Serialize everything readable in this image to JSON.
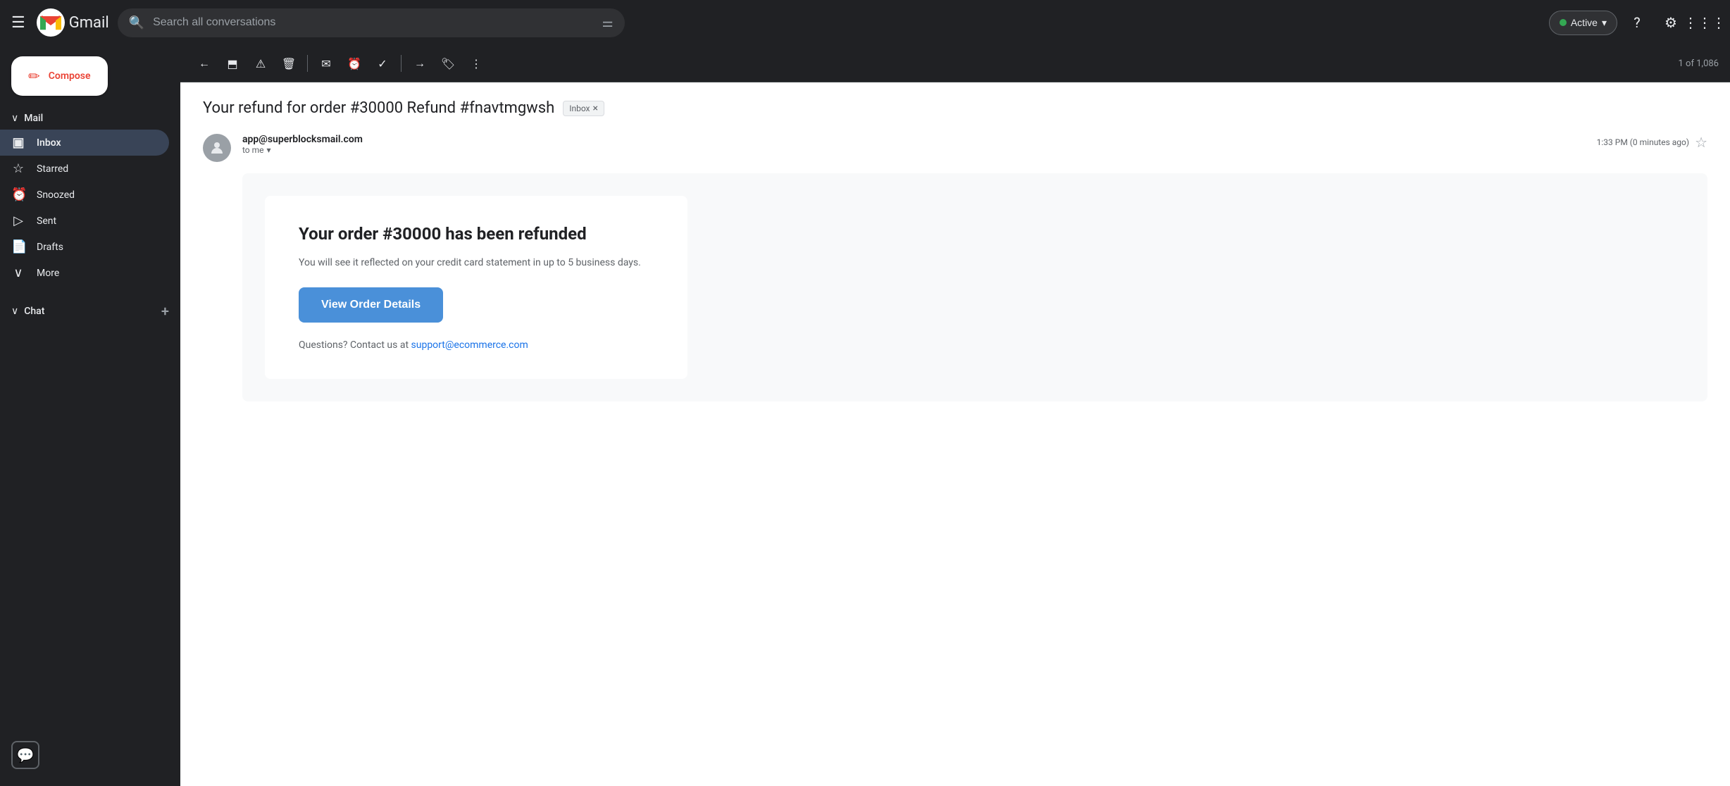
{
  "topbar": {
    "hamburger_label": "☰",
    "gmail_label": "Gmail",
    "search_placeholder": "Search all conversations",
    "active_label": "Active",
    "help_icon": "?",
    "settings_icon": "⚙",
    "grid_icon": "⋮⋮⋮"
  },
  "sidebar": {
    "mail_section": "Mail",
    "compose_label": "Compose",
    "nav_items": [
      {
        "icon": "▣",
        "label": "Inbox",
        "active": true
      },
      {
        "icon": "☆",
        "label": "Starred"
      },
      {
        "icon": "⏰",
        "label": "Snoozed"
      },
      {
        "icon": "▷",
        "label": "Sent"
      },
      {
        "icon": "📄",
        "label": "Drafts"
      },
      {
        "icon": "∨",
        "label": "More"
      }
    ],
    "chat_section": "Chat",
    "chat_plus": "+"
  },
  "toolbar": {
    "back_icon": "←",
    "archive_icon": "⬒",
    "spam_icon": "⚠",
    "delete_icon": "🗑",
    "divider1": true,
    "mark_unread_icon": "✉",
    "snooze_icon": "⏰",
    "task_icon": "✓",
    "divider2": true,
    "move_icon": "→",
    "label_icon": "◷",
    "more_icon": "⋮",
    "count_text": "1 of 1,086"
  },
  "email": {
    "subject": "Your refund for order #30000 Refund #fnavtmgwsh",
    "inbox_badge": "Inbox",
    "from": "app@superblocksmail.com",
    "to_label": "to me",
    "timestamp": "1:33 PM (0 minutes ago)",
    "body_title": "Your order #30000 has been refunded",
    "body_desc": "You will see it reflected on your credit card statement in up to 5 business days.",
    "cta_label": "View Order Details",
    "contact_text": "Questions? Contact us at",
    "contact_link": "support@ecommerce.com"
  }
}
